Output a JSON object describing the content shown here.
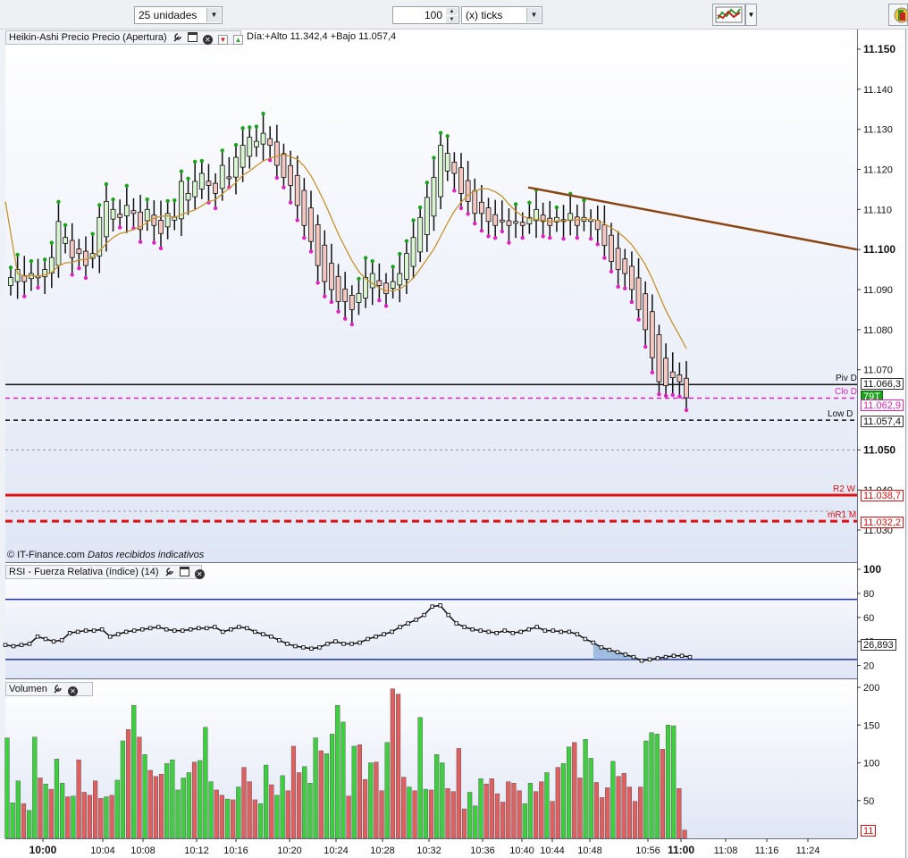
{
  "toolbar": {
    "units_select": "25 unidades",
    "ticks_value": "100",
    "ticks_unit_select": "(x) ticks"
  },
  "price_panel": {
    "title": "Heikin-Ashi Precio Precio (Apertura)",
    "day_info": "Día:+Alto 11.342,4 +Bajo 11.057,4",
    "copyright": "© IT-Finance.com",
    "copyright_note": "Datos recibidos indicativos",
    "level_labels": {
      "piv_d": "Piv D",
      "clo_d": "Clo D",
      "low_d": "Low D",
      "r2_w": "R2 W",
      "mr1_m": "mR1 M"
    },
    "price_boxes": {
      "piv_d": "11.066,3",
      "tick_badge": "79T",
      "clo_d": "11.062,9",
      "low_d": "11.057,4",
      "r2_w": "11.038,7",
      "mr1_m": "11.032,2"
    }
  },
  "rsi_panel": {
    "title": "RSI - Fuerza Relativa (índice) (14)",
    "value_box": "26,893"
  },
  "volume_panel": {
    "title": "Volumen",
    "value_box": "11"
  },
  "colors": {
    "bull": "#1aa31a",
    "bear": "#e06060",
    "ma": "#c8922a",
    "trendline": "#8b4513",
    "rsi_band": "#2233aa",
    "level_red": "#e01010",
    "level_magenta": "#e020c0"
  },
  "chart_data": [
    {
      "type": "candlestick",
      "name": "price",
      "ylim": [
        11.025,
        11.153
      ],
      "yticks": [
        "11.150",
        "11.140",
        "11.130",
        "11.120",
        "11.110",
        "11.100",
        "11.090",
        "11.080",
        "11.070",
        "11.050",
        "11.040",
        "11.030"
      ],
      "xticks": [
        "10:00",
        "10:04",
        "10:08",
        "10:12",
        "10:16",
        "10:20",
        "10:24",
        "10:28",
        "10:32",
        "10:36",
        "10:40",
        "10:44",
        "10:48",
        "10:56",
        "11:00",
        "11:08",
        "11:16",
        "11:24"
      ],
      "levels": [
        {
          "name": "Piv D",
          "value": 11.0663,
          "style": "solid"
        },
        {
          "name": "Clo D",
          "value": 11.0629,
          "style": "dashed"
        },
        {
          "name": "Low D",
          "value": 11.0574,
          "style": "dashed"
        },
        {
          "name": "R2 W",
          "value": 11.0387,
          "style": "solid"
        },
        {
          "name": "mR1 M",
          "value": 11.0322,
          "style": "dashed"
        }
      ],
      "trendline": [
        [
          11.1155,
          11.1
        ],
        [
          11.1155,
          11.1
        ]
      ],
      "candles_close": [
        11.093,
        11.095,
        11.092,
        11.094,
        11.093,
        11.095,
        11.098,
        11.107,
        11.103,
        11.098,
        11.099,
        11.096,
        11.099,
        11.108,
        11.112,
        11.11,
        11.108,
        11.111,
        11.109,
        11.105,
        11.11,
        11.106,
        11.104,
        11.109,
        11.108,
        11.117,
        11.114,
        11.117,
        11.119,
        11.116,
        11.114,
        11.121,
        11.118,
        11.123,
        11.126,
        11.128,
        11.127,
        11.129,
        11.126,
        11.121,
        11.118,
        11.116,
        11.111,
        11.106,
        11.102,
        11.096,
        11.092,
        11.09,
        11.087,
        11.087,
        11.085,
        11.089,
        11.093,
        11.094,
        11.091,
        11.089,
        11.092,
        11.094,
        11.099,
        11.103,
        11.108,
        11.113,
        11.118,
        11.126,
        11.124,
        11.119,
        11.114,
        11.112,
        11.109,
        11.109,
        11.107,
        11.106,
        11.107,
        11.106,
        11.107,
        11.106,
        11.108,
        11.11,
        11.107,
        11.106,
        11.108,
        11.107,
        11.109,
        11.106,
        11.108,
        11.107,
        11.105,
        11.101,
        11.097,
        11.095,
        11.094,
        11.09,
        11.085,
        11.08,
        11.073,
        11.067,
        11.066,
        11.068,
        11.067,
        11.063
      ]
    },
    {
      "type": "line",
      "name": "RSI",
      "ylim": [
        10,
        100
      ],
      "yticks": [
        "100",
        "80",
        "60",
        "40",
        "20"
      ],
      "bands": [
        75,
        25
      ],
      "values": [
        37,
        36,
        37,
        38,
        44,
        42,
        40,
        41,
        47,
        48,
        49,
        49,
        50,
        44,
        46,
        48,
        49,
        50,
        51,
        52,
        50,
        49,
        49,
        50,
        51,
        51,
        52,
        48,
        50,
        52,
        51,
        48,
        46,
        44,
        41,
        38,
        36,
        35,
        34,
        35,
        38,
        40,
        38,
        38,
        39,
        42,
        44,
        46,
        48,
        52,
        55,
        58,
        62,
        69,
        70,
        62,
        55,
        52,
        50,
        49,
        48,
        47,
        49,
        47,
        48,
        50,
        52,
        49,
        49,
        48,
        48,
        46,
        42,
        39,
        35,
        33,
        31,
        29,
        27,
        24,
        25,
        26,
        27,
        28,
        28,
        27
      ]
    },
    {
      "type": "bar",
      "name": "Volumen",
      "ylim": [
        0,
        200
      ],
      "yticks": [
        "200",
        "150",
        "100",
        "50"
      ],
      "values": [
        133,
        47,
        76,
        46,
        37,
        134,
        80,
        72,
        65,
        105,
        73,
        55,
        56,
        104,
        61,
        57,
        76,
        53,
        55,
        57,
        77,
        129,
        144,
        176,
        134,
        111,
        90,
        82,
        85,
        99,
        104,
        64,
        80,
        87,
        101,
        103,
        147,
        75,
        64,
        57,
        52,
        51,
        68,
        94,
        75,
        51,
        46,
        97,
        71,
        57,
        83,
        63,
        122,
        87,
        95,
        73,
        133,
        116,
        112,
        138,
        176,
        154,
        56,
        122,
        124,
        78,
        100,
        101,
        63,
        127,
        198,
        191,
        81,
        68,
        63,
        160,
        65,
        64,
        111,
        100,
        66,
        62,
        119,
        39,
        61,
        43,
        79,
        72,
        79,
        59,
        48,
        75,
        73,
        63,
        46,
        73,
        62,
        75,
        87,
        49,
        94,
        99,
        121,
        127,
        80,
        131,
        106,
        74,
        54,
        67,
        102,
        82,
        86,
        68,
        49,
        68,
        129,
        140,
        138,
        118,
        150,
        149,
        66,
        11
      ]
    }
  ]
}
